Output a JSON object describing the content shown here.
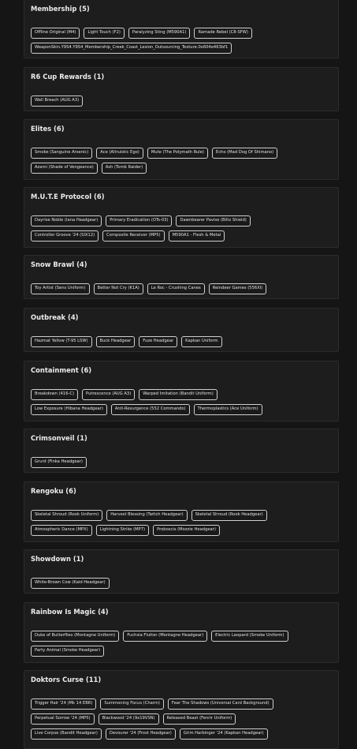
{
  "sections": [
    {
      "title": "Membership (5)",
      "rows": [
        [
          "Offline Original (M4)",
          "Light Touch (F2)",
          "Paralyzing Sting (M590A1)",
          "Ramade Rebel (C8-SFW)"
        ],
        [
          "WeaponSkin.Y9S4.Y9S4_Membership_Creek_Coast_Lesion_Outsourcing_Texture.0x604e463bf1"
        ]
      ]
    },
    {
      "title": "R6 Cup Rewards (1)",
      "rows": [
        [
          "Wall Breach (AUG A3)"
        ]
      ]
    },
    {
      "title": "Elites (6)",
      "rows": [
        [
          "Smoke (Sanguine Arsenic)",
          "Ace (Altruistic Ego)",
          "Mute (The Polymath Rule)",
          "Echo (Mad Dog Of Shimano)"
        ],
        [
          "Azami (Shade of Vengeance)",
          "Ash (Tomb Raider)"
        ]
      ]
    },
    {
      "title": "M.U.T.E Protocol (6)",
      "rows": [
        [
          "Dayrise Noble (Iana Headgear)",
          "Primary Eradication (OTs-03)",
          "Dawnbearer Pavise (Blitz Shield)"
        ],
        [
          "Controller Groove '24 (SIX12)",
          "Composite Receiver (MP5)",
          "M590A1 - Flesh & Metal"
        ]
      ]
    },
    {
      "title": "Snow Brawl (4)",
      "rows": [
        [
          "Toy Artist (Sens Uniform)",
          "Better Not Cry (K1A)",
          "Le Roc - Crushing Canes",
          "Reindeer Games (556XI)"
        ]
      ]
    },
    {
      "title": "Outbreak (4)",
      "rows": [
        [
          "Hazmat Yellow (T-95 LSW)",
          "Buck Headgear",
          "Fuze Headgear",
          "Kapkan Uniform"
        ]
      ]
    },
    {
      "title": "Containment (6)",
      "rows": [
        [
          "Breakdown (416-C)",
          "Putrescence (AUG A3)",
          "Warped Imitation (Bandit Uniform)"
        ],
        [
          "Low Exposure (Hibana Headgear)",
          "Anti-Resurgence (552 Commando)",
          "Thermoplastics (Ace Uniform)"
        ]
      ]
    },
    {
      "title": "Crimsonveil (1)",
      "rows": [
        [
          "Grunt (Finka Headgear)"
        ]
      ]
    },
    {
      "title": "Rengoku (6)",
      "rows": [
        [
          "Skeletal Shroud (Rook Uniform)",
          "Harvest Blessing (Twitch Headgear)",
          "Skeletal Shroud (Rook Headgear)"
        ],
        [
          "Atmospheric Dance (MPX)",
          "Lightning Strike (MP7)",
          "Proboscis (Mozzie Headgear)"
        ]
      ]
    },
    {
      "title": "Showdown (1)",
      "rows": [
        [
          "White-Brown Cow (Kaid Headgear)"
        ]
      ]
    },
    {
      "title": "Rainbow Is Magic (4)",
      "rows": [
        [
          "Duke of Butterflies (Montagne Uniform)",
          "Fuchsia Flutter (Montagne Headgear)",
          "Electric Leopard (Smoke Uniform)"
        ],
        [
          "Party Animal (Smoke Headgear)"
        ]
      ]
    },
    {
      "title": "Doktors Curse (11)",
      "rows": [
        [
          "Trigger Hair '24 (Mk 14 EBR)",
          "Summoning Focus (Charm)",
          "Fear The Shadows (Universal Card Background)"
        ],
        [
          "Perpetual Sorrow '24 (MP5)",
          "Blackwood '24 (9x19VSN)",
          "Released Beast (Fenrir Uniform)"
        ],
        [
          "Live Corpse (Bandit Headgear)",
          "Devourer '24 (Frost Headgear)",
          "Grim Harbinger '24 (Kapkan Headgear)"
        ]
      ]
    }
  ]
}
